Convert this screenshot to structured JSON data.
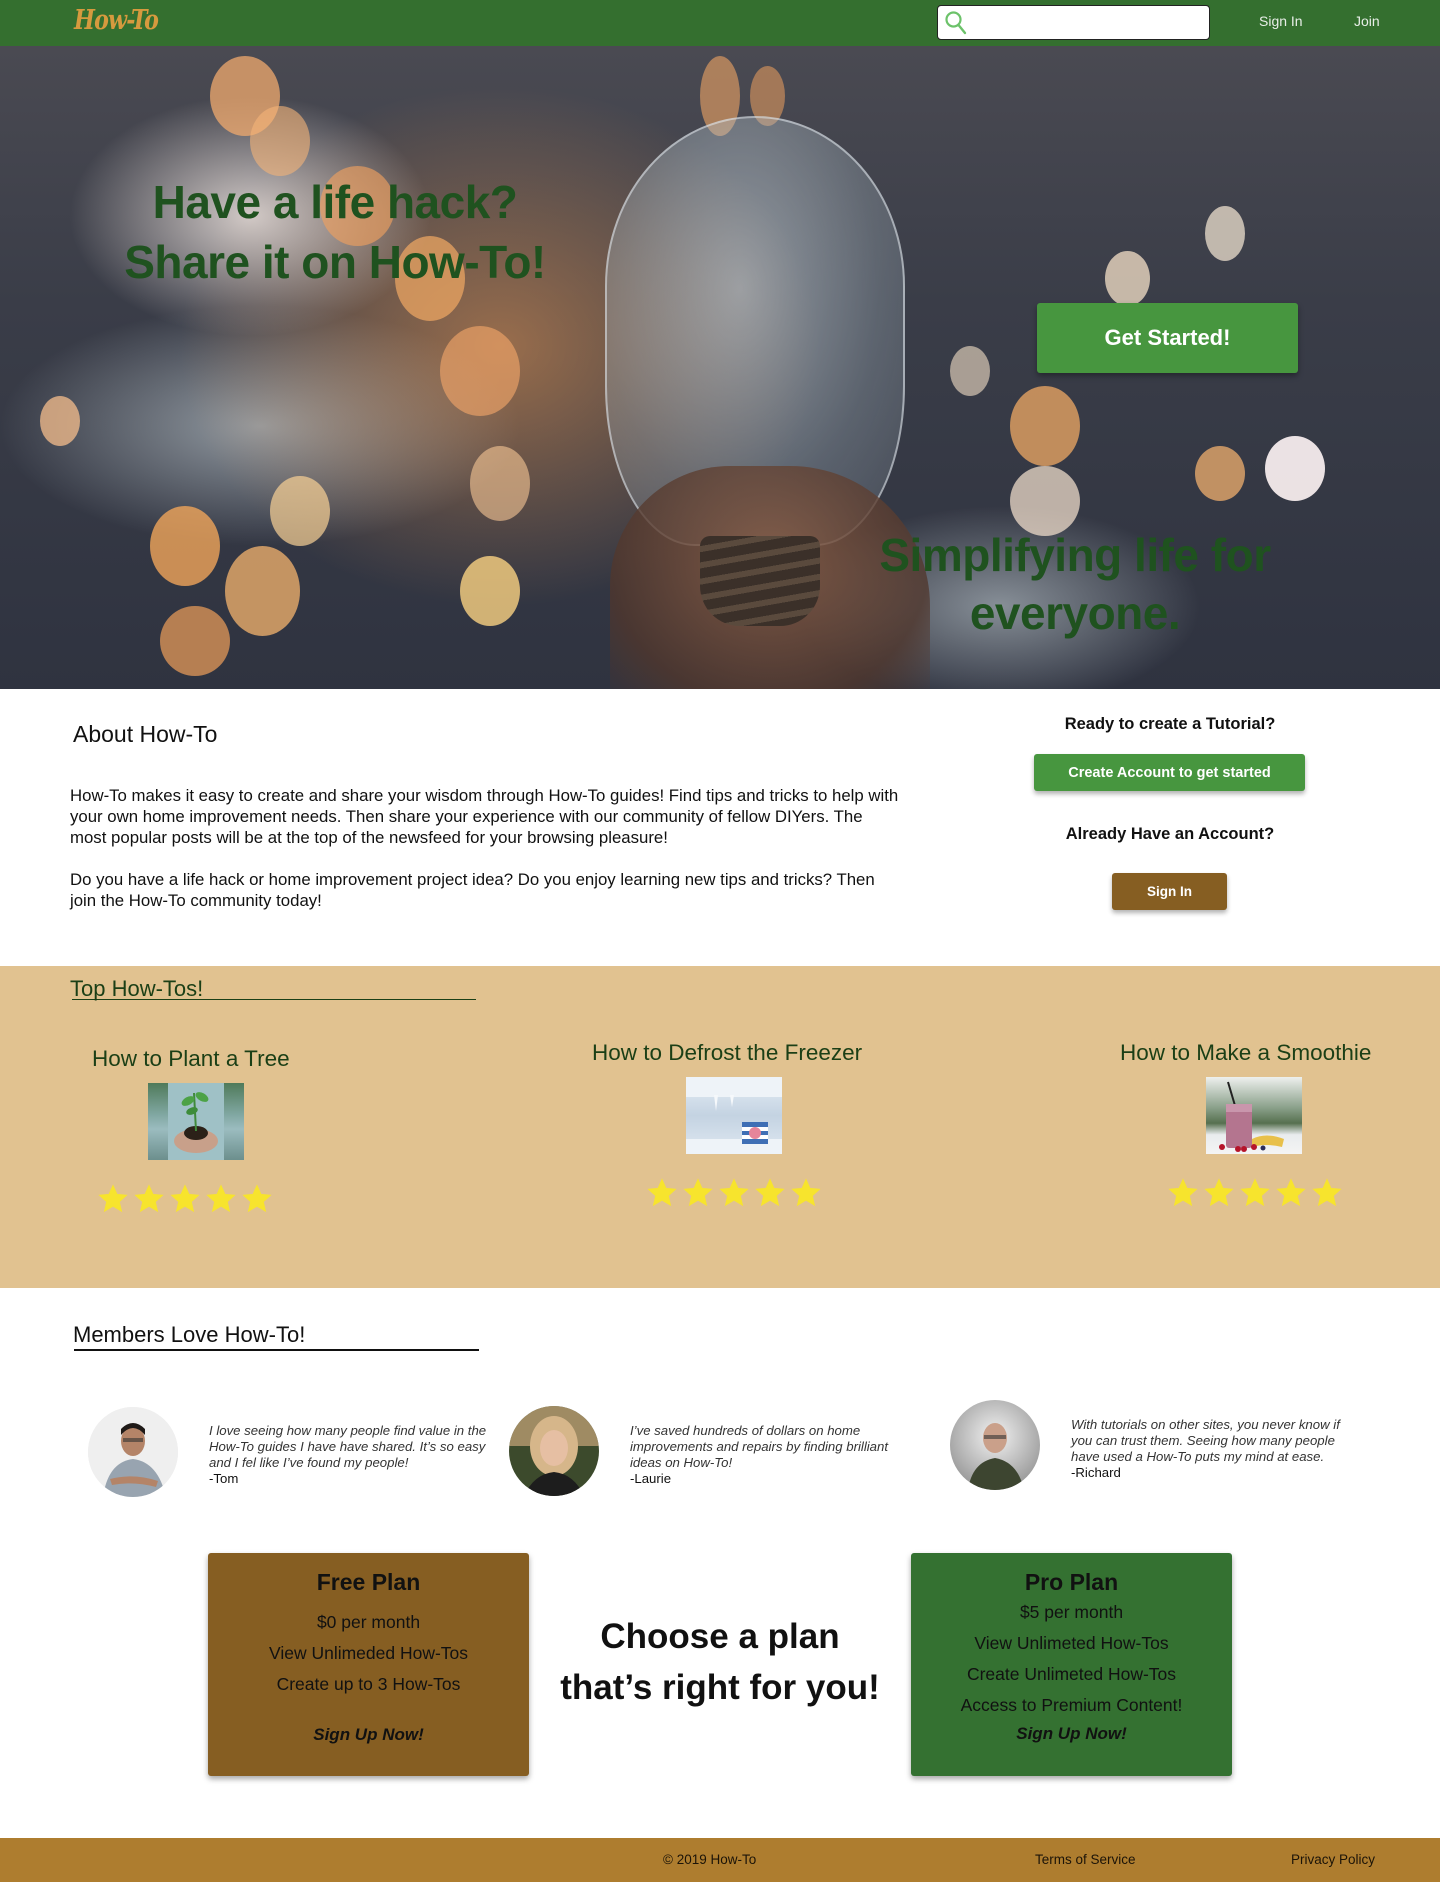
{
  "nav": {
    "logo": "How-To",
    "search": {
      "placeholder": "",
      "value": ""
    },
    "sign_in": "Sign In",
    "join": "Join"
  },
  "hero": {
    "title_line1": "Have a life hack?",
    "title_line2": "Share it on How-To!",
    "cta": "Get Started!",
    "tagline_line1": "Simplifying life for",
    "tagline_line2": "everyone."
  },
  "about": {
    "title": "About How-To",
    "paragraphs": [
      "How-To makes it easy to create and share your wisdom through How-To guides! Find tips and tricks to help with your own home improvement needs. Then share your experience with our community of fellow DIYers. The most popular posts will be at the top of the newsfeed for your browsing pleasure!",
      "Do you have a life hack or home improvement project idea? Do you enjoy learning new tips and tricks? Then join the How-To community today!"
    ]
  },
  "account_cta": {
    "ready_question": "Ready to create a Tutorial?",
    "create_button": "Create Account to get started",
    "existing_question": "Already Have an Account?",
    "sign_in_button": "Sign In"
  },
  "top_howtos": {
    "heading": "Top How-Tos!",
    "items": [
      {
        "title": "How to Plant a Tree",
        "image": "seedling-in-hands",
        "rating": 5,
        "max_rating": 5
      },
      {
        "title": "How to Defrost the Freezer",
        "image": "frosted-freezer",
        "rating": 5,
        "max_rating": 5
      },
      {
        "title": "How to Make a Smoothie",
        "image": "berry-smoothie",
        "rating": 5,
        "max_rating": 5
      }
    ]
  },
  "members": {
    "heading": "Members Love How-To!",
    "testimonials": [
      {
        "quote": "I love seeing how many people find value in the How-To guides I have have shared. It’s so easy and I fel like I’ve found my people!",
        "author": "-Tom"
      },
      {
        "quote": "I’ve saved hundreds of dollars on home improvements and repairs by finding brilliant ideas on How-To!",
        "author": "-Laurie"
      },
      {
        "quote": "With tutorials on other sites, you never know if you can trust them. Seeing how many people have used a How-To puts my mind at ease.",
        "author": "-Richard"
      }
    ]
  },
  "plans": {
    "headline_line1": "Choose a plan",
    "headline_line2": "that’s right for you!",
    "free": {
      "name": "Free Plan",
      "features": [
        "$0 per month",
        "View Unlimeded How-Tos",
        "Create up to 3 How-Tos"
      ],
      "cta": "Sign Up Now!"
    },
    "pro": {
      "name": "Pro Plan",
      "features": [
        "$5 per month",
        "View Unlimeted How-Tos",
        "Create Unlimeted How-Tos",
        "Access to Premium Content!"
      ],
      "cta": "Sign Up Now!"
    }
  },
  "footer": {
    "copyright": "© 2019 How-To",
    "terms": "Terms of Service",
    "privacy": "Privacy Policy"
  },
  "colors": {
    "nav_green": "#346f2f",
    "button_green": "#47963f",
    "heading_green": "#1f521f",
    "logo_orange": "#d69a3e",
    "brown": "#865e22",
    "tan": "#e1c290",
    "footer_gold": "#ae7d2f",
    "star_yellow": "#f7e42d"
  }
}
